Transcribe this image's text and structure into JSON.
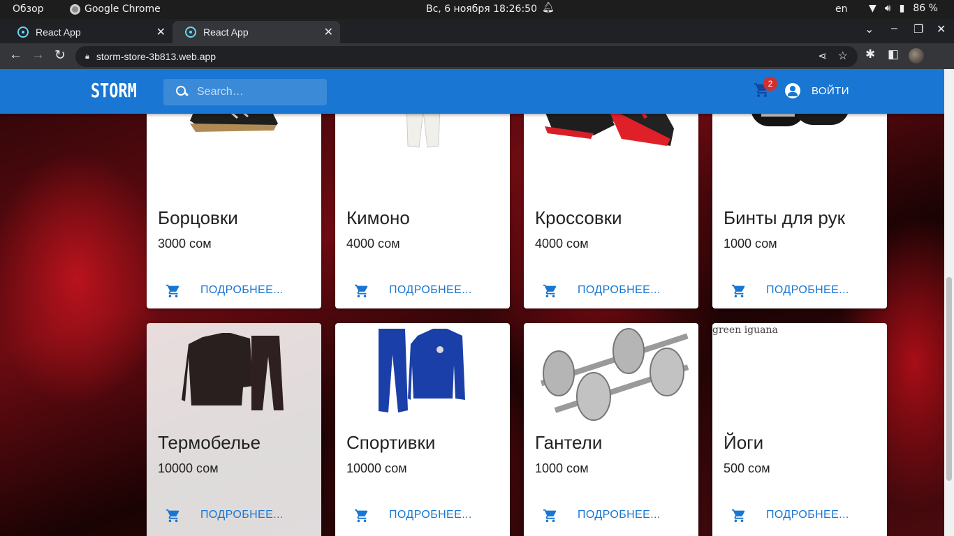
{
  "system": {
    "overview": "Обзор",
    "app_name": "Google Chrome",
    "datetime": "Вс, 6 ноября  18:26:50",
    "lang": "en",
    "battery": "86 %"
  },
  "tabs": [
    {
      "title": "React App"
    },
    {
      "title": "React App"
    }
  ],
  "address": {
    "url": "storm-store-3b813.web.app"
  },
  "header": {
    "logo": "STORM",
    "search_placeholder": "Search…",
    "cart_count": "2",
    "login_label": "ВОЙТИ"
  },
  "more_label": "ПОДРОБНЕЕ...",
  "products": [
    {
      "title": "Борцовки",
      "price": "3000 сом",
      "icon": "wrestling-shoes-image"
    },
    {
      "title": "Кимоно",
      "price": "4000 сом",
      "icon": "kimono-image"
    },
    {
      "title": "Кроссовки",
      "price": "4000 сом",
      "icon": "sneakers-image"
    },
    {
      "title": "Бинты для рук",
      "price": "1000 сом",
      "icon": "hand-wraps-image"
    },
    {
      "title": "Термобелье",
      "price": "10000 сом",
      "icon": "thermal-underwear-image"
    },
    {
      "title": "Спортивки",
      "price": "10000 сом",
      "icon": "tracksuit-image"
    },
    {
      "title": "Гантели",
      "price": "1000 сом",
      "icon": "dumbbells-image"
    },
    {
      "title": "Йоги",
      "price": "500 сом",
      "icon": "broken-image",
      "alt": "green iguana"
    }
  ],
  "colors": {
    "appbar": "#1976d2",
    "link": "#1976d2",
    "badge": "#d32f2f"
  }
}
